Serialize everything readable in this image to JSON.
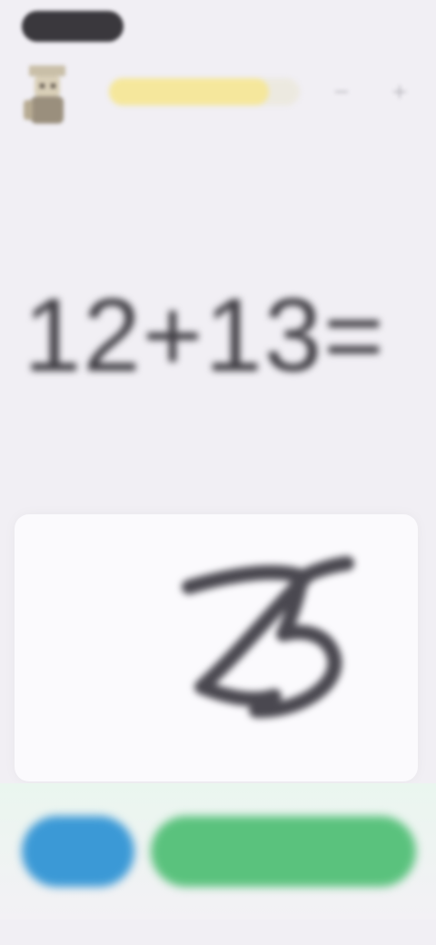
{
  "header": {
    "progress": 0.84,
    "progress_color": "#f5e79c",
    "avatar_icon": "character-avatar-icon",
    "icons": [
      "minus-icon",
      "plus-icon"
    ]
  },
  "problem": {
    "equation": "12+13="
  },
  "answer_pad": {
    "handwritten_answer": "25"
  },
  "buttons": {
    "clear": {
      "label": "",
      "color": "#3b99d6",
      "icon": "erase-icon"
    },
    "check": {
      "label": "",
      "color": "#5ac27d"
    }
  },
  "colors": {
    "background": "#f1eff4",
    "ink": "#3f3d43"
  }
}
